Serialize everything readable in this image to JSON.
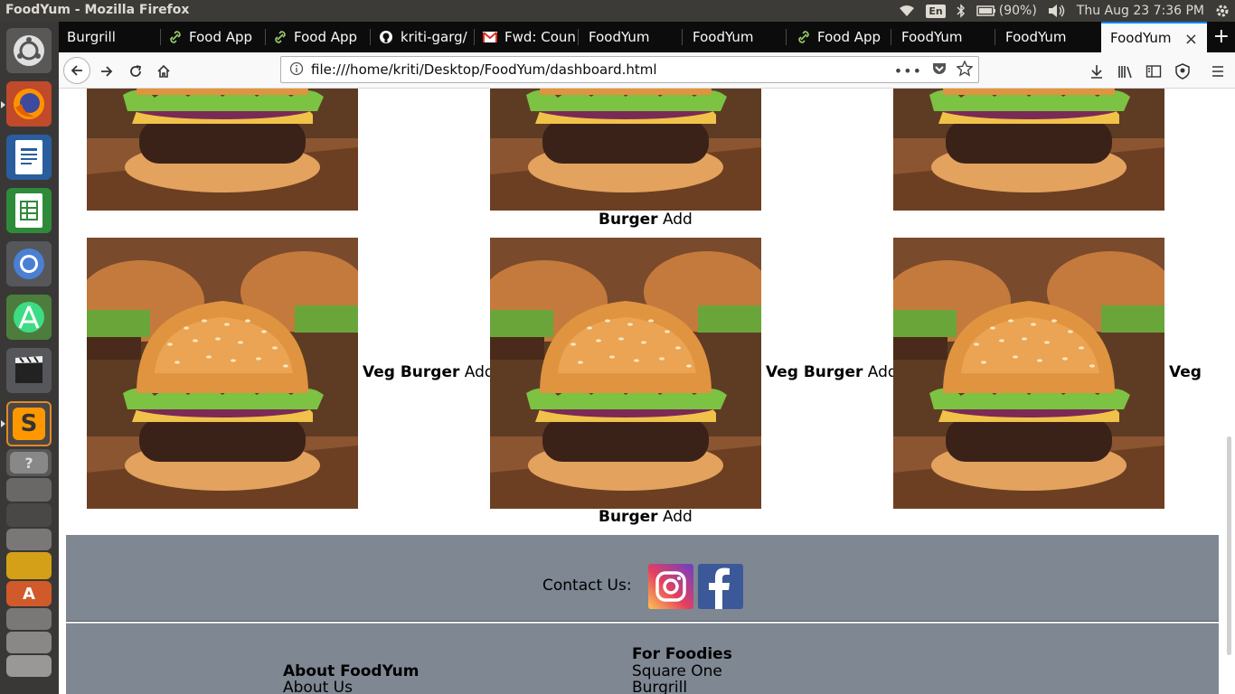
{
  "os": {
    "window_title": "FoodYum - Mozilla Firefox",
    "keyboard": "En",
    "battery": "(90%)",
    "clock": "Thu Aug 23  7:36 PM"
  },
  "browser": {
    "tabs": [
      {
        "label": "Burgrill",
        "icon": "none"
      },
      {
        "label": "Food App",
        "icon": "link-icon"
      },
      {
        "label": "Food App",
        "icon": "link-icon"
      },
      {
        "label": "kriti-garg/",
        "icon": "github-icon"
      },
      {
        "label": "Fwd: Coun",
        "icon": "gmail-icon"
      },
      {
        "label": "FoodYum",
        "icon": "none"
      },
      {
        "label": "FoodYum",
        "icon": "none"
      },
      {
        "label": "Food App",
        "icon": "link-icon"
      },
      {
        "label": "FoodYum",
        "icon": "none"
      },
      {
        "label": "FoodYum",
        "icon": "none"
      },
      {
        "label": "FoodYum",
        "icon": "none",
        "active": true
      }
    ],
    "url": "file:///home/kriti/Desktop/FoodYum/dashboard.html"
  },
  "menu": {
    "rows": [
      {
        "items": [
          {
            "name": "Burger",
            "action": "Add"
          }
        ]
      },
      {
        "items": [
          {
            "name": "Veg Burger",
            "action": "Add"
          },
          {
            "name": "Veg Burger",
            "action": "Add"
          },
          {
            "name": "Veg",
            "action": ""
          },
          {
            "name": "Burger",
            "action": "Add"
          }
        ]
      }
    ]
  },
  "footer": {
    "contact_label": "Contact Us:",
    "social": [
      "instagram-icon",
      "facebook-icon"
    ],
    "about_heading": "About FoodYum",
    "about_links": [
      "About Us"
    ],
    "foodies_heading": "For Foodies",
    "foodies_links": [
      "Square One",
      "Burgrill"
    ]
  },
  "colors": {
    "footer_bg": "#7e8792",
    "tab_active_accent": "#0a84ff",
    "facebook_blue": "#3b5998"
  }
}
